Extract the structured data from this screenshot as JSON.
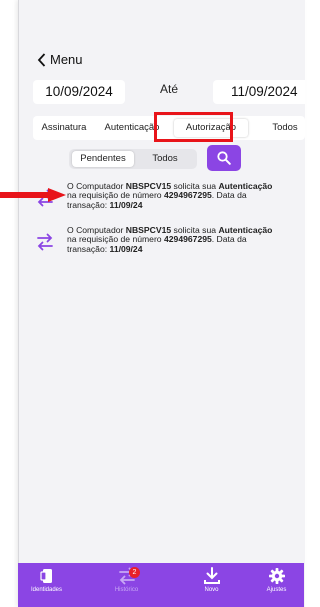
{
  "header": {
    "back_label": "Menu"
  },
  "date_filter": {
    "from": "10/09/2024",
    "separator": "Até",
    "to": "11/09/2024"
  },
  "tabs": [
    {
      "label": "Assinatura"
    },
    {
      "label": "Autenticação"
    },
    {
      "label": "Autorização"
    },
    {
      "label": "Todos"
    }
  ],
  "selected_tab": "Autorização",
  "segment": {
    "pending_label": "Pendentes",
    "all_label": "Todos"
  },
  "requests": [
    {
      "prefix": "O Computador ",
      "device": "NBSPCV15",
      "middle": " solicita sua ",
      "type": "Autenticação",
      "line2_prefix": "na requisição de número ",
      "number": "4294967295",
      "line2_suffix": ". Data da",
      "line3_prefix": "transação: ",
      "date": "11/09/24"
    },
    {
      "prefix": "O Computador ",
      "device": "NBSPCV15",
      "middle": " solicita sua ",
      "type": "Autenticação",
      "line2_prefix": "na requisição de número ",
      "number": "4294967295",
      "line2_suffix": ". Data da",
      "line3_prefix": "transação: ",
      "date": "11/09/24"
    }
  ],
  "tabbar": {
    "identidades": "Identidades",
    "historico": "Histórico",
    "historico_badge": "2",
    "novo": "Novo",
    "ajustes": "Ajustes"
  },
  "colors": {
    "accent": "#8b45e4",
    "highlight": "#e8141a",
    "badge": "#e8202b"
  }
}
